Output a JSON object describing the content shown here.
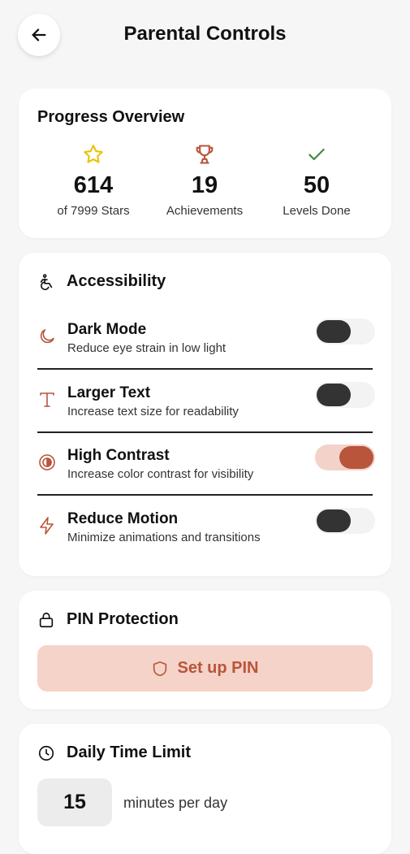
{
  "header": {
    "title": "Parental Controls"
  },
  "progress": {
    "title": "Progress Overview",
    "stats": [
      {
        "value": "614",
        "label": "of 7999 Stars",
        "icon": "star-icon"
      },
      {
        "value": "19",
        "label": "Achievements",
        "icon": "trophy-icon"
      },
      {
        "value": "50",
        "label": "Levels Done",
        "icon": "check-icon"
      }
    ]
  },
  "accessibility": {
    "title": "Accessibility",
    "settings": [
      {
        "title": "Dark Mode",
        "desc": "Reduce eye strain in low light",
        "enabled": false
      },
      {
        "title": "Larger Text",
        "desc": "Increase text size for readability",
        "enabled": false
      },
      {
        "title": "High Contrast",
        "desc": "Increase color contrast for visibility",
        "enabled": true
      },
      {
        "title": "Reduce Motion",
        "desc": "Minimize animations and transitions",
        "enabled": false
      }
    ]
  },
  "pin": {
    "title": "PIN Protection",
    "button_label": "Set up PIN"
  },
  "time_limit": {
    "title": "Daily Time Limit",
    "minutes": "15",
    "unit_label": "minutes per day"
  },
  "colors": {
    "accent": "#b8553a",
    "accent_light": "#f5d3c8",
    "star": "#e8c300",
    "check": "#3e8a3e"
  }
}
